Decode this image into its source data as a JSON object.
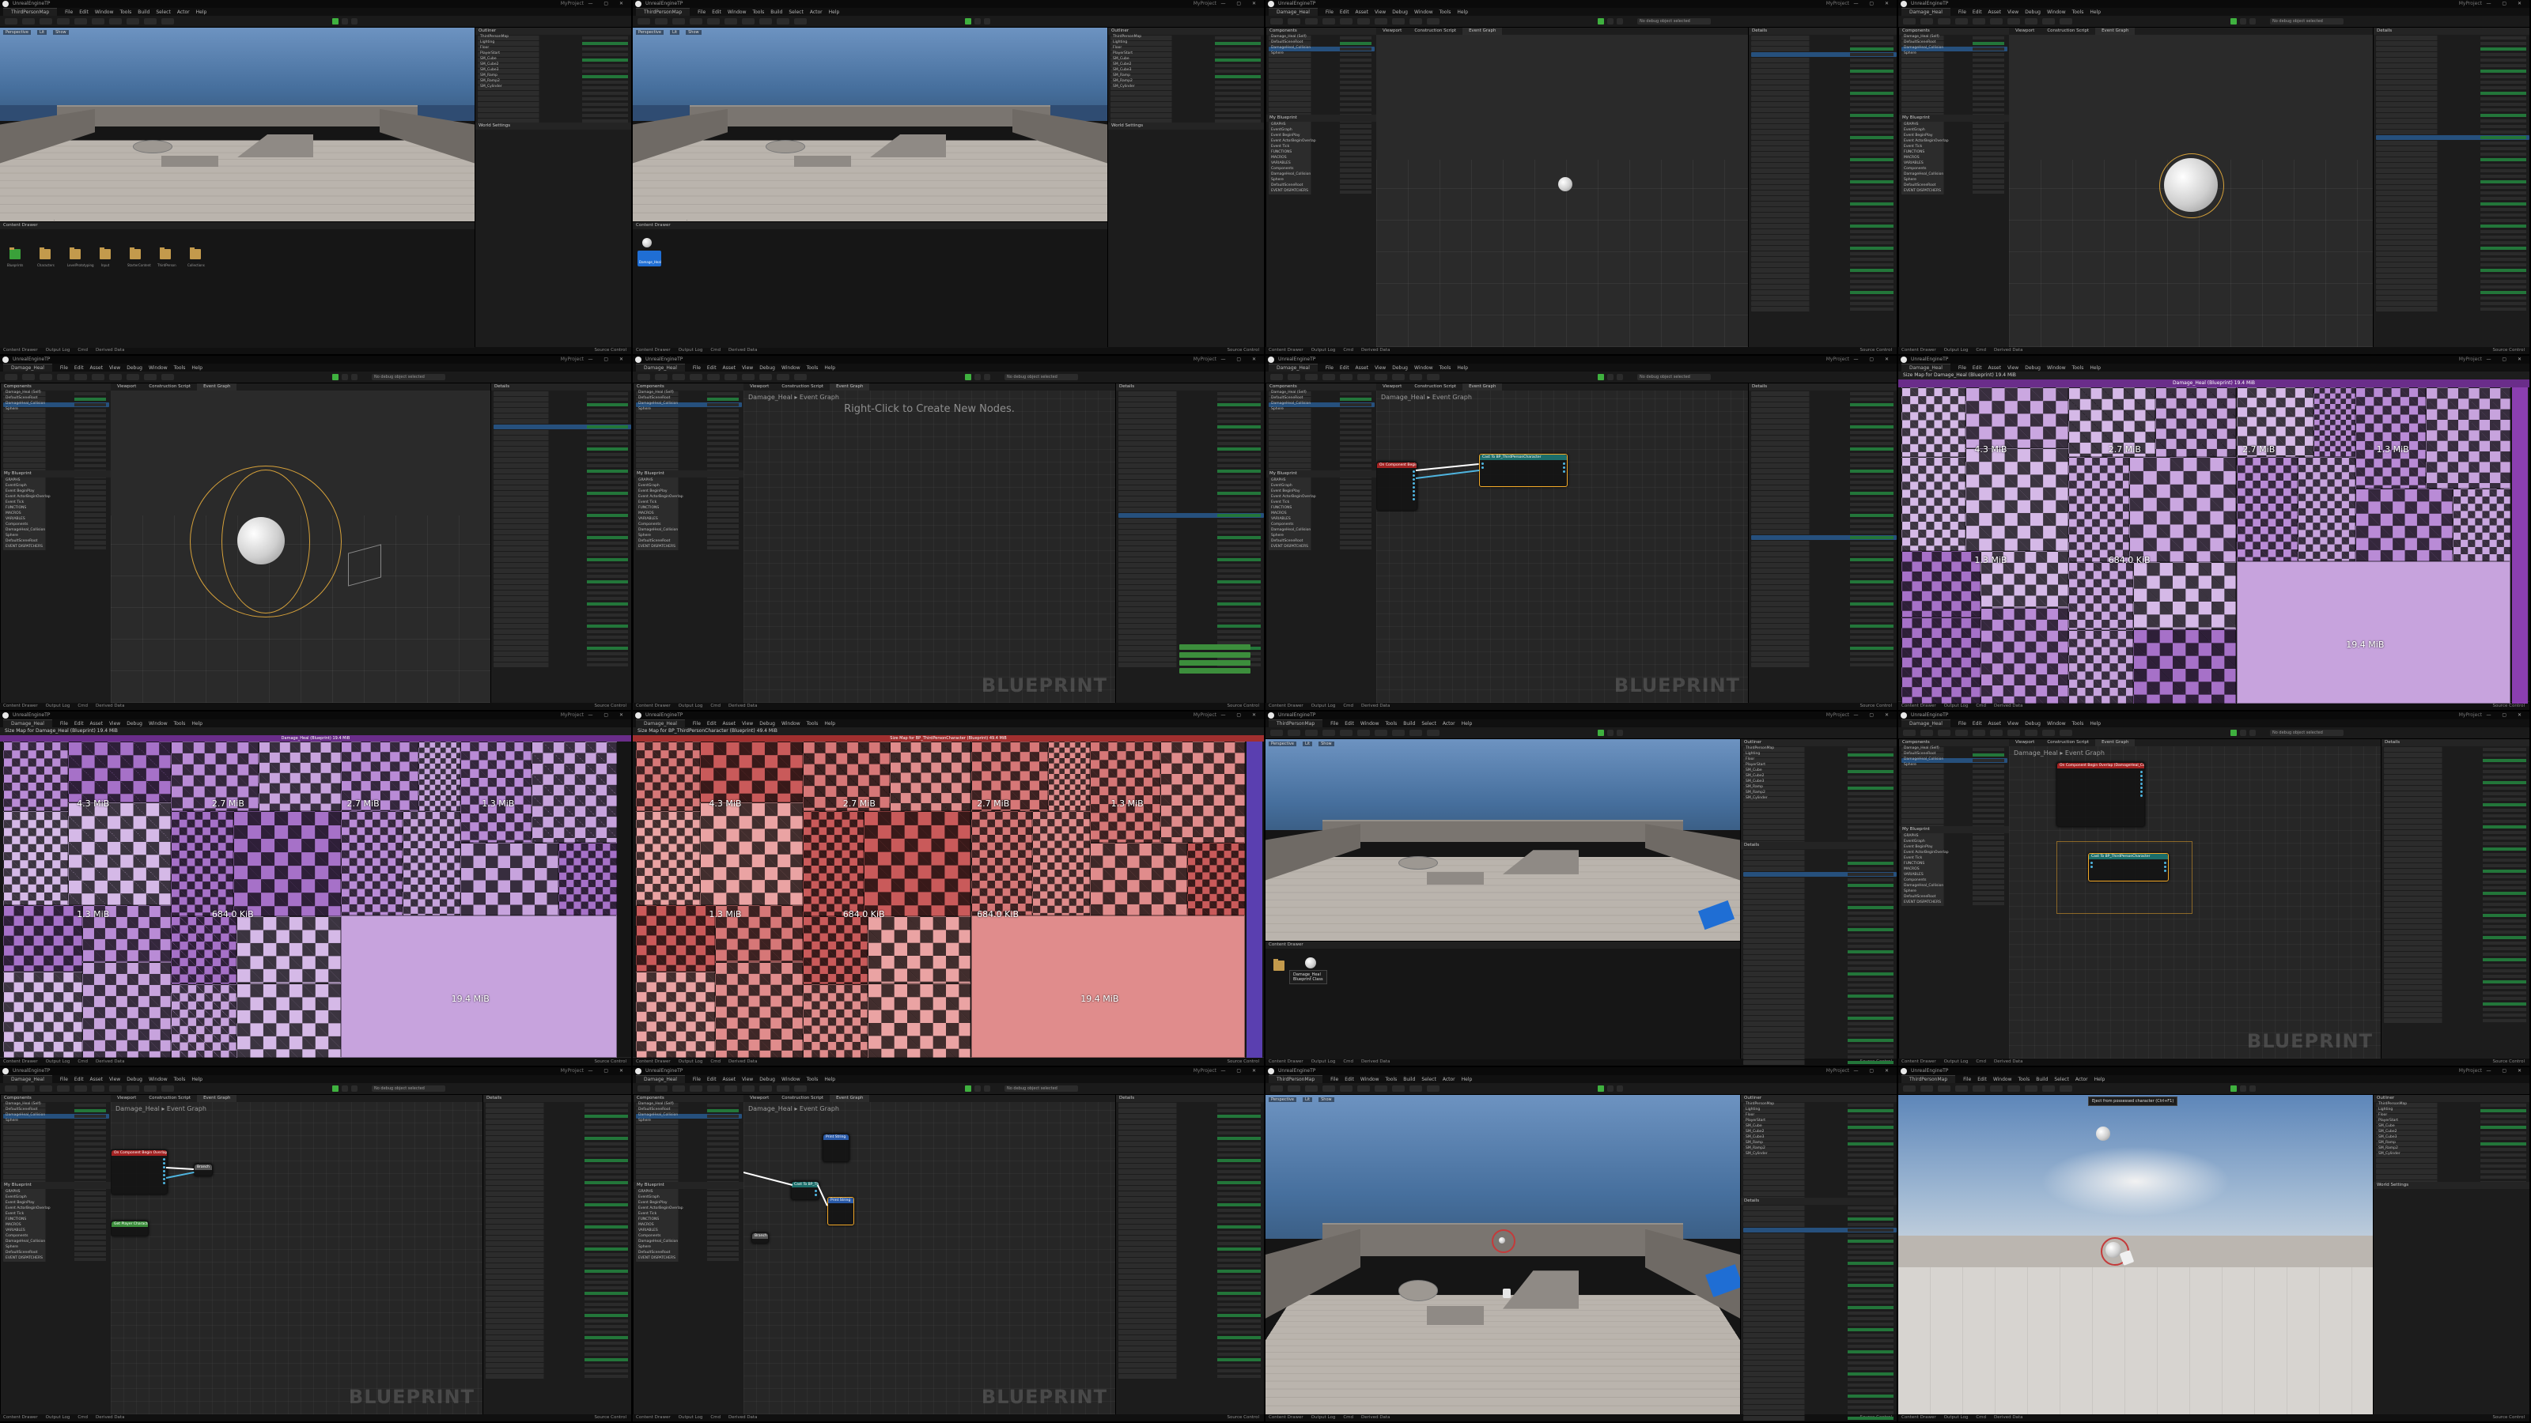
{
  "app": {
    "window_title": "UnrealEngineTP",
    "project_label": "MyProject",
    "menu": [
      "File",
      "Edit",
      "Window",
      "Tools",
      "Build",
      "Select",
      "Actor",
      "Help"
    ],
    "bp_menu": [
      "File",
      "Edit",
      "Asset",
      "View",
      "Debug",
      "Window",
      "Tools",
      "Help"
    ],
    "level_tab": "ThirdPersonMap",
    "bp_tab": "Damage_Heal",
    "status": [
      "Content Drawer",
      "Output Log",
      "Cmd",
      "Derived Data"
    ],
    "source_control": "Source Control"
  },
  "viewport_menu": [
    "Perspective",
    "Lit",
    "Show"
  ],
  "outliner": {
    "title": "Outliner",
    "rows": [
      "ThirdPersonMap",
      "Lighting",
      "Floor",
      "PlayerStart",
      "SM_Cube",
      "SM_Cube2",
      "SM_Cube3",
      "SM_Ramp",
      "SM_Ramp2",
      "SM_Cylinder"
    ]
  },
  "details": {
    "title": "Details",
    "world_settings": "World Settings",
    "rows": [
      "Transform",
      "Location",
      "Rotation",
      "Scale",
      "Static Mesh",
      "Materials",
      "Physics",
      "Collision",
      "Lighting",
      "Rendering"
    ]
  },
  "content_browser": {
    "title": "Content Drawer",
    "folders": [
      "Blueprints",
      "Characters",
      "LevelPrototyping",
      "Input",
      "StarterContent",
      "ThirdPerson",
      "Collections"
    ],
    "selected_asset": "Damage_Heal",
    "tooltip_lines": [
      "Damage_Heal",
      "Blueprint Class"
    ]
  },
  "components": {
    "title": "Components",
    "rows": [
      "Damage_Heal (Self)",
      "DefaultSceneRoot",
      "DamageHeal_Collision",
      "Sphere"
    ],
    "my_blueprint": "My Blueprint",
    "mybp_rows": [
      "GRAPHS",
      "EventGraph",
      "Event BeginPlay",
      "Event ActorBeginOverlap",
      "Event Tick",
      "FUNCTIONS",
      "MACROS",
      "VARIABLES",
      "Components",
      "DamageHeal_Collision",
      "Sphere",
      "DefaultSceneRoot",
      "EVENT DISPATCHERS"
    ]
  },
  "bp_editor": {
    "tabs": [
      "Viewport",
      "Construction Script",
      "Event Graph"
    ],
    "breadcrumb": "Damage_Heal ▸ Event Graph",
    "hint": "Right-Click to Create New Nodes.",
    "watermark": "BLUEPRINT",
    "toolbar": [
      "Compile",
      "Save",
      "Browse",
      "Diff",
      "Find",
      "Hide Unrelated",
      "Class Settings",
      "Class Defaults",
      "Simulate",
      "Play"
    ],
    "debug_filter": "No debug object selected"
  },
  "nodes": {
    "overlap_event": "On Component Begin Overlap (DamageHeal_Collision)",
    "overlap_pins": [
      "Overlapped Component",
      "Other Actor",
      "Other Comp",
      "Other Body Index",
      "From Sweep",
      "Sweep Result"
    ],
    "cast_node": "Cast To BP_ThirdPersonCharacter",
    "cast_pins": [
      "Object",
      "Cast Failed",
      "As BP ThirdPerson Character"
    ],
    "print_node": "Print String",
    "player_index": "Get Player Character",
    "branch": "Branch",
    "event_tick": "Event Tick"
  },
  "size_map": {
    "header_a": "Size Map for Damage_Heal (Blueprint) 19.4 MiB",
    "header_b": "Size Map for BP_ThirdPersonCharacter (Blueprint) 49.4 MiB",
    "header_title": "Damage_Heal (Blueprint) 19.4 MiB",
    "root_total": "19.4 MiB",
    "cells": [
      "4.3 MiB",
      "2.7 MiB",
      "2.7 MiB",
      "1.3 MiB",
      "1.3 MiB",
      "684.0 KiB",
      "684.0 KiB"
    ]
  },
  "pie": {
    "tooltip": "Eject from possessed character (Ctrl+F1)"
  },
  "colors": {
    "accent": "#f3a928",
    "select": "#26507d",
    "event_red": "#a32222",
    "cast_teal": "#1c6e6a",
    "func_blue": "#2a5aa8",
    "purple": "#8b3fb0",
    "red": "#b23a3a",
    "green_exec": "#3fb13f"
  }
}
